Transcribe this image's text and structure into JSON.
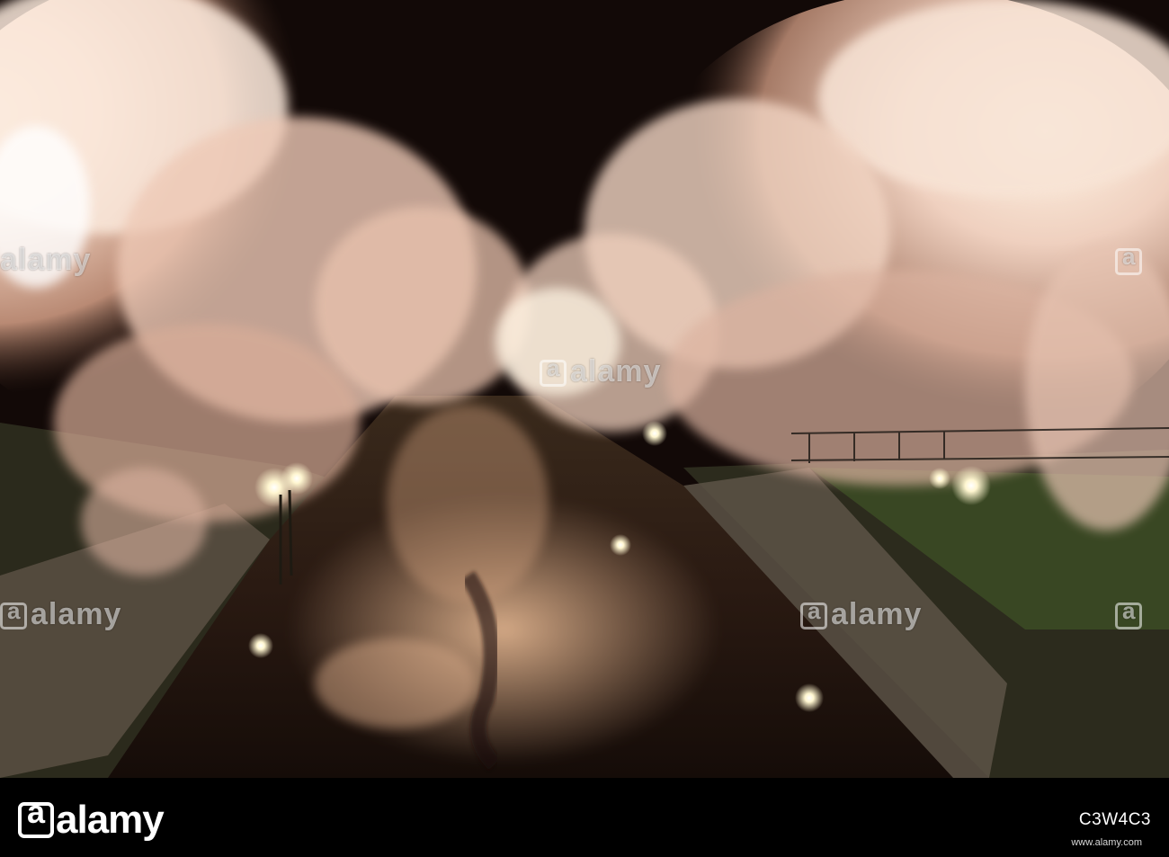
{
  "photo": {
    "subject": "night-lit cherry blossoms over a canal",
    "colors": {
      "sky": "#140a08",
      "blossom": "#f5d7c7",
      "glow": "#fff3dc",
      "water": "#2a1a12"
    }
  },
  "watermark": {
    "text": "alamy"
  },
  "footer": {
    "logo_text": "alamy",
    "image_id": "www.alamy.com",
    "image_code": "C3W4C3"
  }
}
